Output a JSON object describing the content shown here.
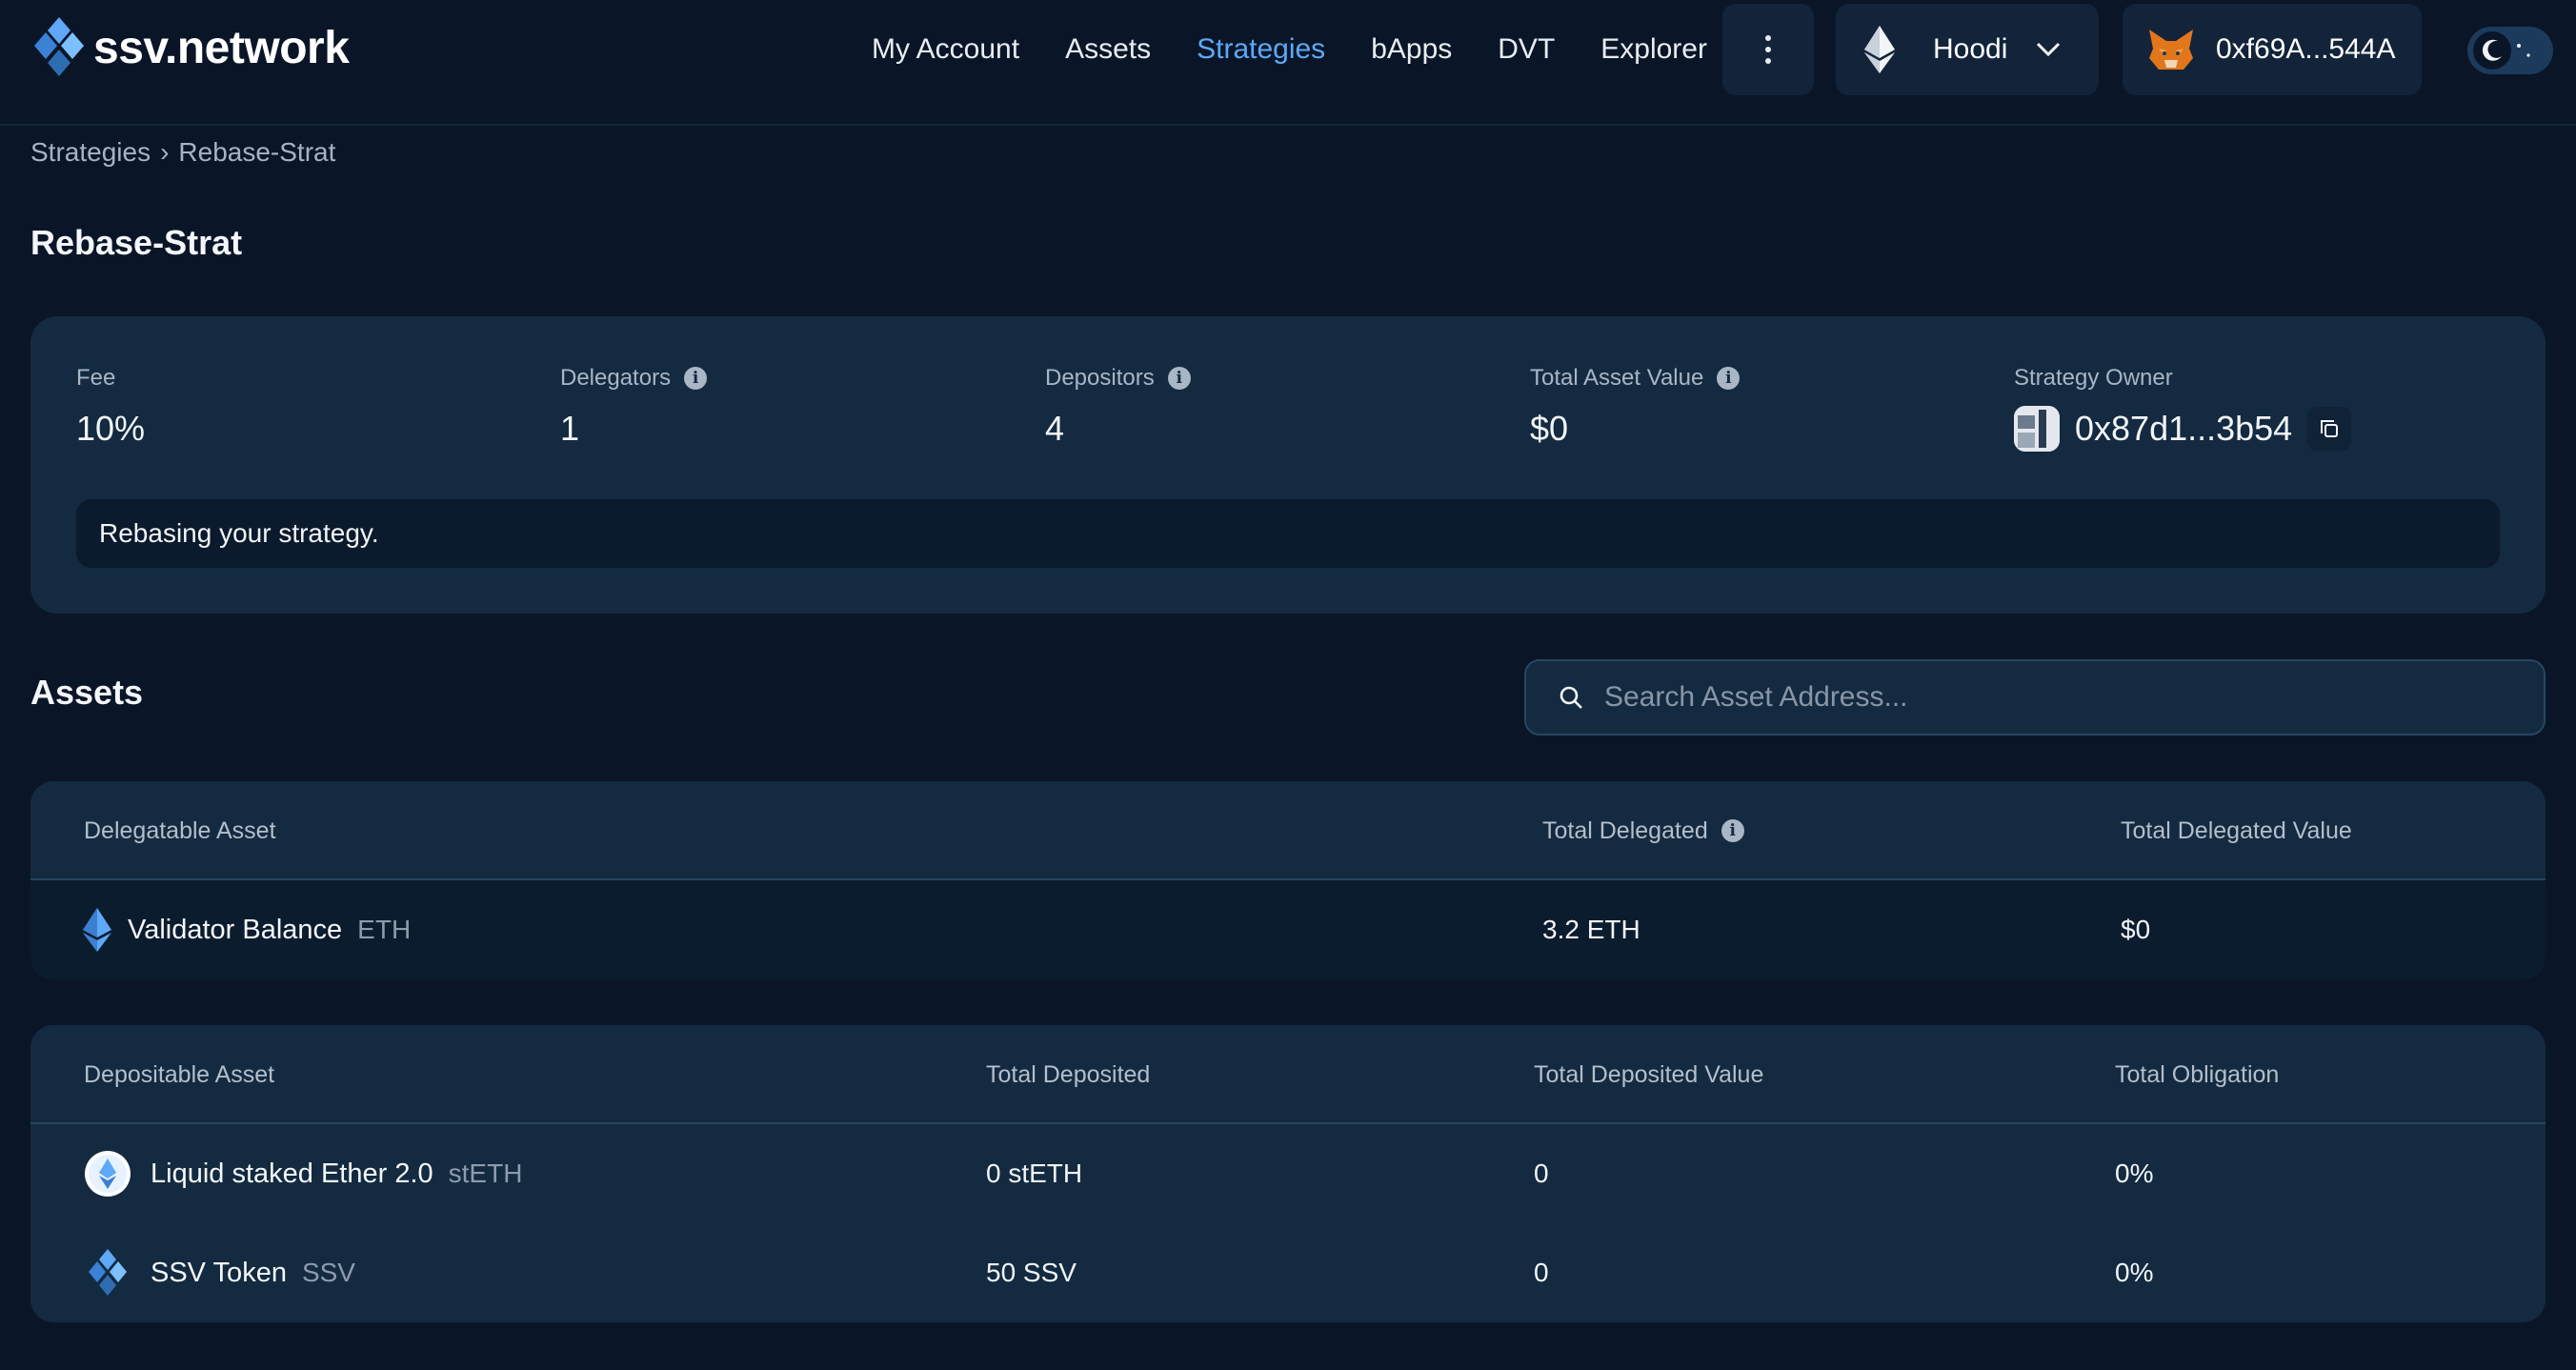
{
  "brand": {
    "name": "ssv.network"
  },
  "nav": {
    "items": [
      {
        "label": "My Account",
        "active": false
      },
      {
        "label": "Assets",
        "active": false
      },
      {
        "label": "Strategies",
        "active": true
      },
      {
        "label": "bApps",
        "active": false
      },
      {
        "label": "DVT",
        "active": false
      },
      {
        "label": "Explorer",
        "active": false
      }
    ]
  },
  "network": {
    "label": "Hoodi"
  },
  "wallet": {
    "address": "0xf69A...544A"
  },
  "breadcrumb": {
    "parent": "Strategies",
    "separator": "›",
    "current": "Rebase-Strat"
  },
  "page": {
    "title": "Rebase-Strat"
  },
  "stats": {
    "fee": {
      "label": "Fee",
      "value": "10%"
    },
    "delegators": {
      "label": "Delegators",
      "value": "1"
    },
    "depositors": {
      "label": "Depositors",
      "value": "4"
    },
    "total_asset_value": {
      "label": "Total Asset Value",
      "value": "$0"
    },
    "owner": {
      "label": "Strategy Owner",
      "value": "0x87d1...3b54"
    }
  },
  "banner": {
    "text": "Rebasing your strategy."
  },
  "assets": {
    "title": "Assets",
    "search_placeholder": "Search Asset Address..."
  },
  "delegatable_table": {
    "headers": {
      "asset": "Delegatable Asset",
      "total": "Total Delegated",
      "value": "Total Delegated Value"
    },
    "rows": [
      {
        "name": "Validator Balance",
        "symbol": "ETH",
        "total": "3.2 ETH",
        "value": "$0"
      }
    ]
  },
  "depositable_table": {
    "headers": {
      "asset": "Depositable Asset",
      "total": "Total Deposited",
      "value": "Total Deposited Value",
      "obligation": "Total Obligation"
    },
    "rows": [
      {
        "name": "Liquid staked Ether 2.0",
        "symbol": "stETH",
        "total": "0 stETH",
        "value": "0",
        "obligation": "0%"
      },
      {
        "name": "SSV Token",
        "symbol": "SSV",
        "total": "50 SSV",
        "value": "0",
        "obligation": "0%"
      }
    ]
  },
  "colors": {
    "accent": "#5ea8f7",
    "background": "#0a1628",
    "card": "#132a40"
  }
}
